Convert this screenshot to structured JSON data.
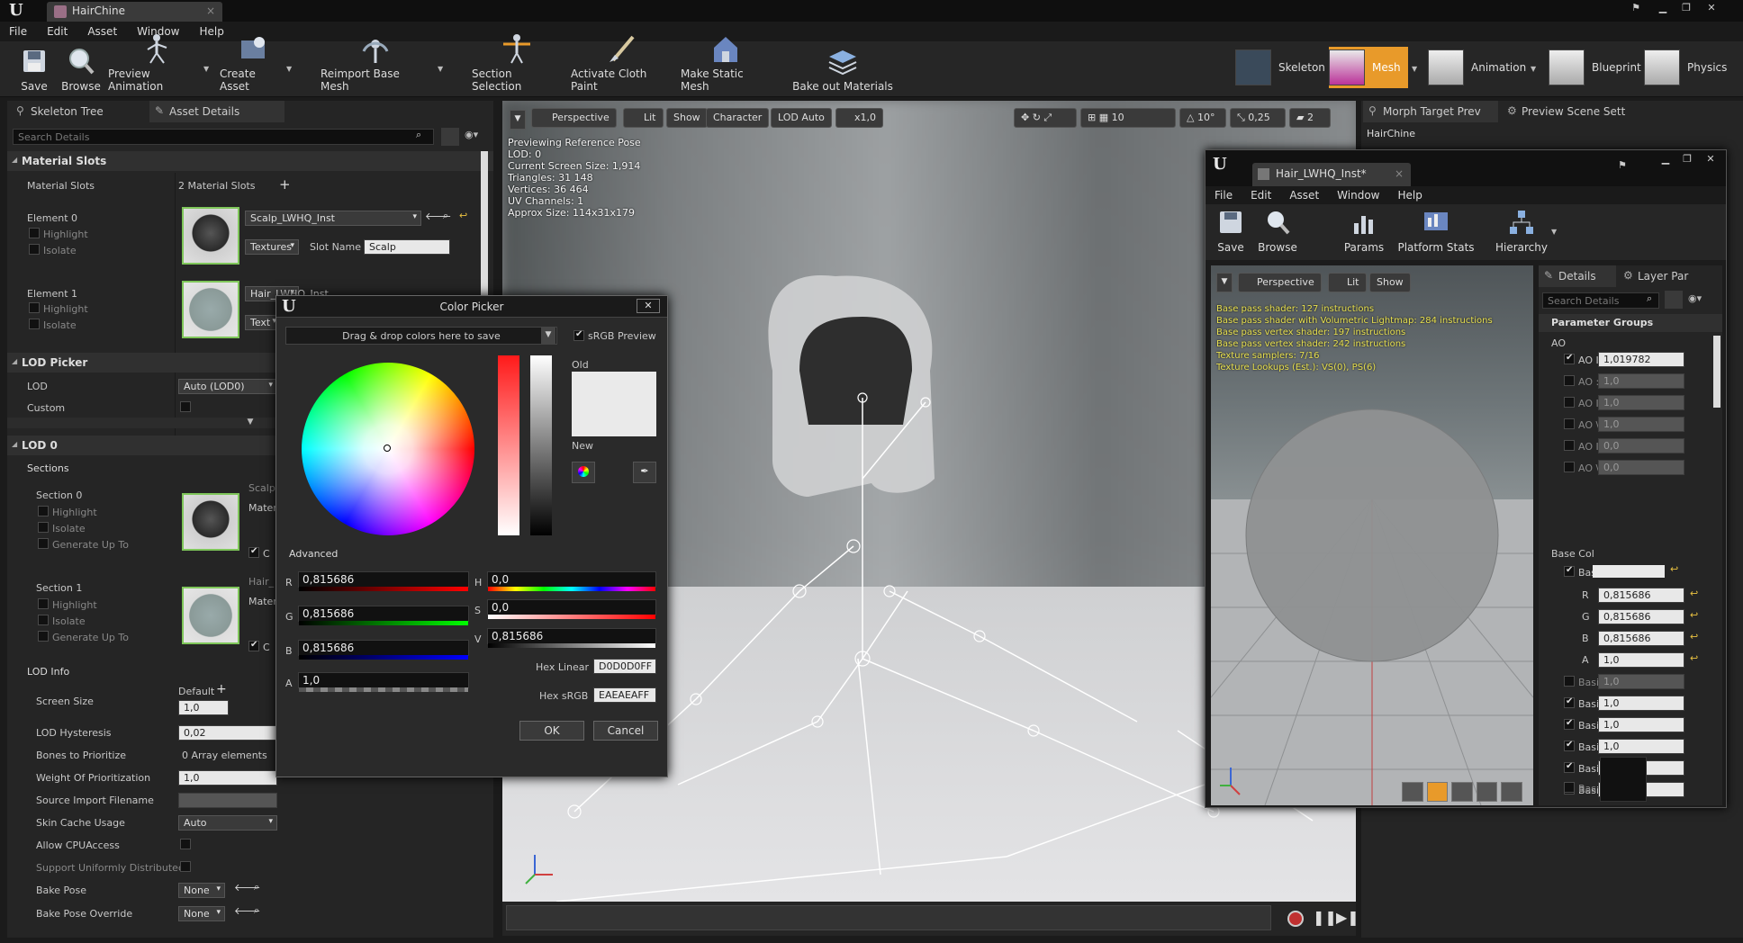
{
  "titlebar": {
    "tab": "HairChine"
  },
  "menubar": [
    "File",
    "Edit",
    "Asset",
    "Window",
    "Help"
  ],
  "toolbar": {
    "items": [
      "Save",
      "Browse",
      "Preview Animation",
      "Create Asset",
      "Reimport Base Mesh",
      "Section Selection",
      "Activate Cloth Paint",
      "Make Static Mesh",
      "Bake out Materials"
    ],
    "modes": [
      "Skeleton",
      "Mesh",
      "Animation",
      "Blueprint",
      "Physics"
    ]
  },
  "left": {
    "tabs": [
      "Skeleton Tree",
      "Asset Details"
    ],
    "search_placeholder": "Search Details",
    "material_slots": {
      "header": "Material Slots",
      "label": "Material Slots",
      "count": "2 Material Slots",
      "element0": "Element 0",
      "element1": "Element 1",
      "highlight": "Highlight",
      "isolate": "Isolate",
      "mat0": "Scalp_LWHQ_Inst",
      "mat1": "Hair_LWHQ_Inst",
      "textures": "Textures",
      "slot_name_label": "Slot Name",
      "slot_name": "Scalp",
      "text_trunc": "Text"
    },
    "lod_picker": {
      "header": "LOD Picker",
      "lod_label": "LOD",
      "lod_value": "Auto (LOD0)",
      "custom_label": "Custom"
    },
    "lod0": {
      "header": "LOD 0",
      "sections": "Sections",
      "section0": "Section 0",
      "section1": "Section 1",
      "highlight": "Highlight",
      "isolate": "Isolate",
      "gen": "Generate Up To",
      "scalp": "Scalp",
      "hair": "Hair_",
      "mater": "Mater",
      "c": "C",
      "lod_info": "LOD Info",
      "default": "Default",
      "screen_size_label": "Screen Size",
      "screen_size": "1,0",
      "hyst_label": "LOD Hysteresis",
      "hyst": "0,02",
      "bones_label": "Bones to Prioritize",
      "bones": "0 Array elements",
      "weight_label": "Weight Of Prioritization",
      "weight": "1,0",
      "src_label": "Source Import Filename",
      "skin_label": "Skin Cache Usage",
      "skin": "Auto",
      "cpu_label": "Allow CPUAccess",
      "uniform_label": "Support Uniformly Distributed",
      "bake_label": "Bake Pose",
      "bake": "None",
      "bake_override_label": "Bake Pose Override",
      "bake_override": "None"
    }
  },
  "viewport": {
    "buttons": [
      "Perspective",
      "Lit",
      "Show",
      "Character",
      "LOD Auto",
      "x1,0"
    ],
    "right_values": [
      "10",
      "10°",
      "0,25",
      "2"
    ],
    "info": [
      "Previewing Reference Pose",
      "LOD: 0",
      "Current Screen Size: 1,914",
      "Triangles: 31 148",
      "Vertices: 36 464",
      "UV Channels: 1",
      "Approx Size: 114x31x179"
    ]
  },
  "right": {
    "tabs": [
      "Morph Target Prev",
      "Preview Scene Sett"
    ],
    "title": "HairChine"
  },
  "material_editor": {
    "tab": "Hair_LWHQ_Inst*",
    "menu": [
      "File",
      "Edit",
      "Asset",
      "Window",
      "Help"
    ],
    "toolbar": [
      "Save",
      "Browse",
      "Params",
      "Platform Stats",
      "Hierarchy"
    ],
    "vp_buttons": [
      "Perspective",
      "Lit",
      "Show"
    ],
    "stats": [
      "Base pass shader: 127 instructions",
      "Base pass shader with Volumetric Lightmap: 284 instructions",
      "Base pass vertex shader: 197 instructions",
      "Base pass vertex shader: 242 instructions",
      "Texture samplers: 7/16",
      "Texture Lookups (Est.): VS(0), PS(6)"
    ],
    "details_tabs": [
      "Details",
      "Layer Par"
    ],
    "search_placeholder": "Search Details",
    "param_groups": "Parameter Groups",
    "ao": "AO",
    "ao_rows": [
      {
        "label": "AO I",
        "value": "1,019782",
        "on": true
      },
      {
        "label": "AO :",
        "value": "1,0",
        "on": false
      },
      {
        "label": "AO I",
        "value": "1,0",
        "on": false
      },
      {
        "label": "AO \\",
        "value": "1,0",
        "on": false
      },
      {
        "label": "AO I",
        "value": "0,0",
        "on": false
      },
      {
        "label": "AO \\",
        "value": "0,0",
        "on": false
      }
    ],
    "base_col": "Base Col",
    "bas": "Bas",
    "rgba": [
      {
        "label": "R",
        "value": "0,815686"
      },
      {
        "label": "G",
        "value": "0,815686"
      },
      {
        "label": "B",
        "value": "0,815686"
      },
      {
        "label": "A",
        "value": "1,0"
      }
    ],
    "base_rows": [
      {
        "label": "Basi",
        "value": "1,0",
        "on": false
      },
      {
        "label": "Basi",
        "value": "1,0",
        "on": true
      },
      {
        "label": "Basi",
        "value": "1,0",
        "on": true
      },
      {
        "label": "Basi",
        "value": "1,0",
        "on": true
      },
      {
        "label": "Basi",
        "value": "0,0",
        "on": true
      },
      {
        "label": "Basi",
        "value": "0,0",
        "on": true
      }
    ],
    "bas_last": "Bas"
  },
  "picker": {
    "title": "Color Picker",
    "drag": "Drag & drop colors here to save",
    "srgb": "sRGB Preview",
    "old": "Old",
    "new": "New",
    "advanced": "Advanced",
    "r_label": "R",
    "r": "0,815686",
    "g_label": "G",
    "g": "0,815686",
    "b_label": "B",
    "b": "0,815686",
    "a_label": "A",
    "a": "1,0",
    "h_label": "H",
    "h": "0,0",
    "s_label": "S",
    "s": "0,0",
    "v_label": "V",
    "v": "0,815686",
    "hex_linear_label": "Hex Linear",
    "hex_linear": "D0D0D0FF",
    "hex_srgb_label": "Hex sRGB",
    "hex_srgb": "EAEAEAFF",
    "ok": "OK",
    "cancel": "Cancel"
  },
  "colors": {
    "accent": "#e89a2a",
    "green": "#7fc65a",
    "blue": "#4a7fd0"
  }
}
